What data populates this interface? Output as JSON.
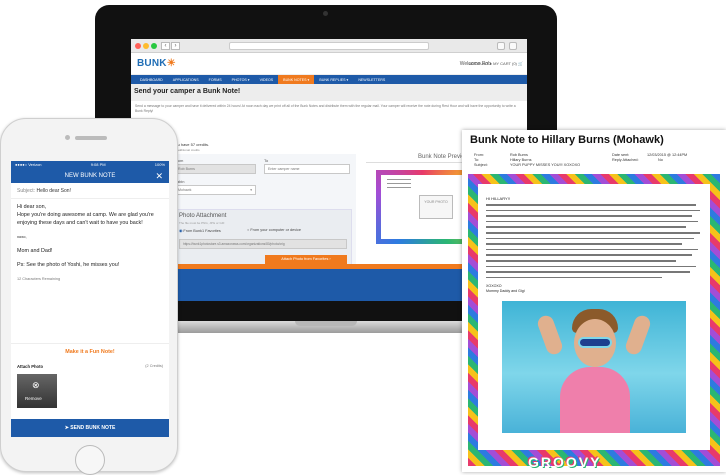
{
  "laptop": {
    "logo_text": "BUNK",
    "welcome": "Welcome Rob",
    "account_label": "ACCOUNT",
    "cart_label": "MY CART (0)",
    "nav": [
      "DASHBOARD",
      "APPLICATIONS",
      "FORMS",
      "PHOTOS ▾",
      "VIDEOS",
      "BUNK NOTES ▾",
      "BUNK REPLIES ▾",
      "NEWSLETTERS"
    ],
    "nav_active_index": 5,
    "page_title": "Send your camper a Bunk Note!",
    "intro": "Send a message to your camper and have it delivered within 24 hours! At noon each day we print off all of the Bunk Notes and distribute them with the regular mail. Your camper will receive the note during Rest Hour and will have the opportunity to write a Bunk Reply!",
    "credits": "You have 57 credits.",
    "credits_sub": "16 additional credits",
    "from_label": "From",
    "from_value": "Rob Burns",
    "to_label": "To",
    "to_placeholder": "Enter camper name",
    "cabin_label": "Cabin",
    "cabin_value": "Mohawk",
    "photo_attach_title": "Photo Attachment",
    "photo_attach_sub": "The file must be PNG, JPG or GIF",
    "radio_favorites": "From Bunk1 Favorites",
    "radio_computer": "From your computer or device",
    "url_value": "https://bunk1photostore.s3.amazonaws.com/organizations/80/photo/orig",
    "attach_button": "Attach Photo from Favorites",
    "preview_title": "Bunk Note Preview",
    "preview_photo": "YOUR PHOTO"
  },
  "note": {
    "title": "Bunk Note to Hillary Burns (Mohawk)",
    "from_label": "From:",
    "from_value": "Rob Burns",
    "to_label": "To:",
    "to_value": "Hillary Burns",
    "subject_label": "Subject:",
    "subject_value": "YOUR PUPPY MISSES YOU!!! XOXOXO",
    "date_label": "Date sent:",
    "date_value": "12/03/2015 @ 12:44PM",
    "reply_label": "Reply Attached:",
    "reply_value": "No",
    "greeting": "HI HILLARY!!",
    "signoff1": "XOXOXO",
    "signoff2": "Mommy Daddy and Gigi",
    "border_word": "GROOVY"
  },
  "phone": {
    "carrier": "●●●●○ Verizon",
    "time": "9:08 PM",
    "battery": "100%",
    "app_title": "NEW BUNK NOTE",
    "subject_label": "Subject:",
    "subject_value": "Hello dear Son!",
    "message": [
      "Hi dear son,",
      "Hope you're doing awesome at camp. We are glad you're enjoying these days and can't wait to have you back!",
      "xoxo,",
      "Mom and Dad!",
      "Ps: See the photo of Yoshi, he misses you!"
    ],
    "chars_remaining": "12 Characters Remaining",
    "fun_note_link": "Make it a Fun Note!",
    "attach_photo_label": "Attach Photo",
    "attach_credits": "(2 Credits)",
    "remove_label": "Remove",
    "send_button": "SEND BUNK NOTE"
  },
  "colors": {
    "brand_blue": "#1e5aa8",
    "brand_orange": "#f07a1e"
  }
}
